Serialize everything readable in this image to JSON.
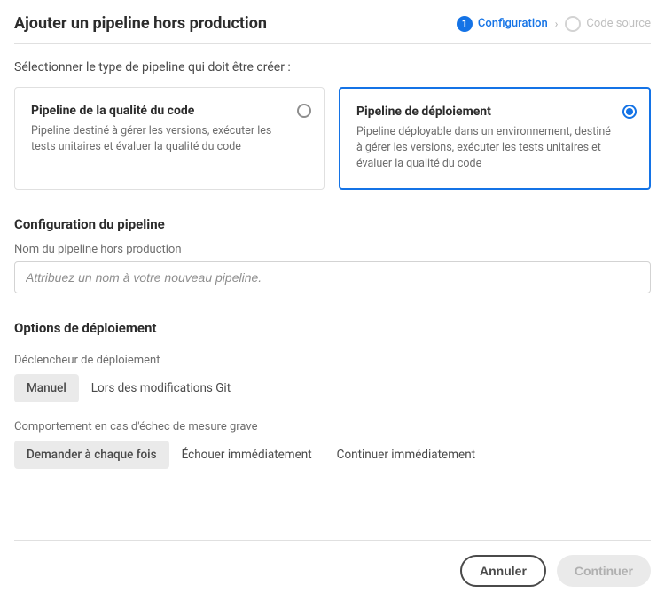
{
  "header": {
    "title": "Ajouter un pipeline hors production",
    "steps": [
      {
        "number": "1",
        "label": "Configuration",
        "active": true
      },
      {
        "label": "Code source",
        "active": false
      }
    ]
  },
  "selection_prompt": "Sélectionner le type de pipeline qui doit être créer :",
  "pipeline_types": [
    {
      "title": "Pipeline de la qualité du code",
      "description": "Pipeline destiné à gérer les versions, exécuter les tests unitaires et évaluer la qualité du code",
      "selected": false
    },
    {
      "title": "Pipeline de déploiement",
      "description": "Pipeline déployable dans un environnement, destiné à gérer les versions, exécuter les tests unitaires et évaluer la qualité du code",
      "selected": true
    }
  ],
  "config": {
    "section_title": "Configuration du pipeline",
    "name_label": "Nom du pipeline hors production",
    "name_placeholder": "Attribuez un nom à votre nouveau pipeline."
  },
  "deployment": {
    "section_title": "Options de déploiement",
    "trigger_label": "Déclencheur de déploiement",
    "trigger_options": [
      "Manuel",
      "Lors des modifications Git"
    ],
    "trigger_selected": "Manuel",
    "failure_label": "Comportement en cas d'échec de mesure grave",
    "failure_options": [
      "Demander à chaque fois",
      "Échouer immédiatement",
      "Continuer immédiatement"
    ],
    "failure_selected": "Demander à chaque fois"
  },
  "footer": {
    "cancel": "Annuler",
    "continue": "Continuer"
  }
}
